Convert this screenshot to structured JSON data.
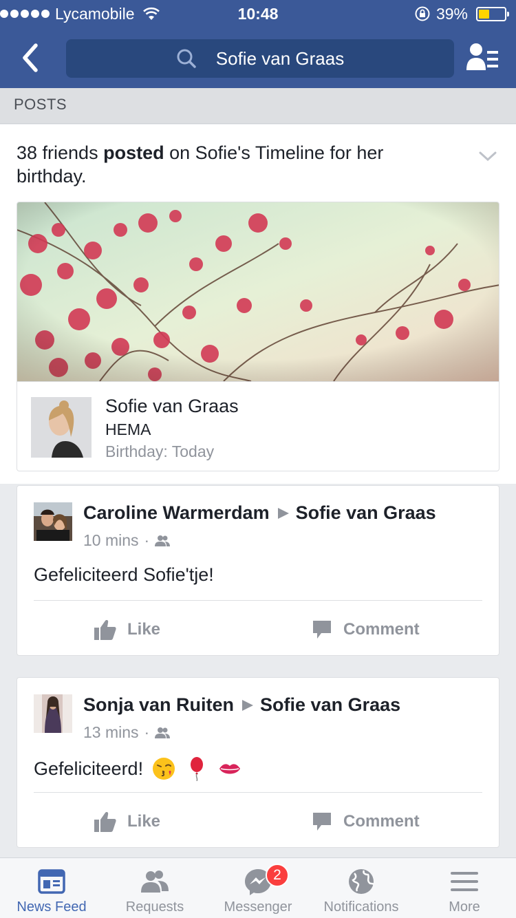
{
  "status_bar": {
    "carrier": "Lycamobile",
    "time": "10:48",
    "battery": "39%",
    "battery_level": 0.39
  },
  "nav": {
    "search_query": "Sofie van Graas",
    "icons": [
      "back-chevron-icon",
      "search-icon",
      "friends-list-icon"
    ]
  },
  "section": {
    "title": "POSTS"
  },
  "birthday": {
    "text_prefix": "38 friends ",
    "text_bold": "posted",
    "text_suffix": " on Sofie's Timeline for her birthday.",
    "name": "Sofie van Graas",
    "work": "HEMA",
    "birthday_label": "Birthday: Today"
  },
  "posts": [
    {
      "author": "Caroline Warmerdam",
      "target": "Sofie van Graas",
      "time": "10 mins",
      "privacy": "·",
      "message": "Gefeliciteerd Sofie'tje!",
      "emojis": [],
      "like_label": "Like",
      "comment_label": "Comment"
    },
    {
      "author": "Sonja van Ruiten",
      "target": "Sofie van Graas",
      "time": "13 mins",
      "privacy": "·",
      "message": "Gefeliciteerd!",
      "emojis": [
        "kissing-face-emoji",
        "balloon-emoji",
        "kiss-mark-emoji"
      ],
      "like_label": "Like",
      "comment_label": "Comment"
    }
  ],
  "tabbar": {
    "tabs": [
      {
        "label": "News Feed",
        "icon": "news-feed-icon",
        "active": true
      },
      {
        "label": "Requests",
        "icon": "friend-requests-icon"
      },
      {
        "label": "Messenger",
        "icon": "messenger-icon",
        "badge": "2"
      },
      {
        "label": "Notifications",
        "icon": "globe-icon"
      },
      {
        "label": "More",
        "icon": "hamburger-icon"
      }
    ]
  },
  "colors": {
    "brand": "#3b5998",
    "active_tab": "#4267b2",
    "badge": "#fa3e3e",
    "muted_text": "#90949c"
  }
}
